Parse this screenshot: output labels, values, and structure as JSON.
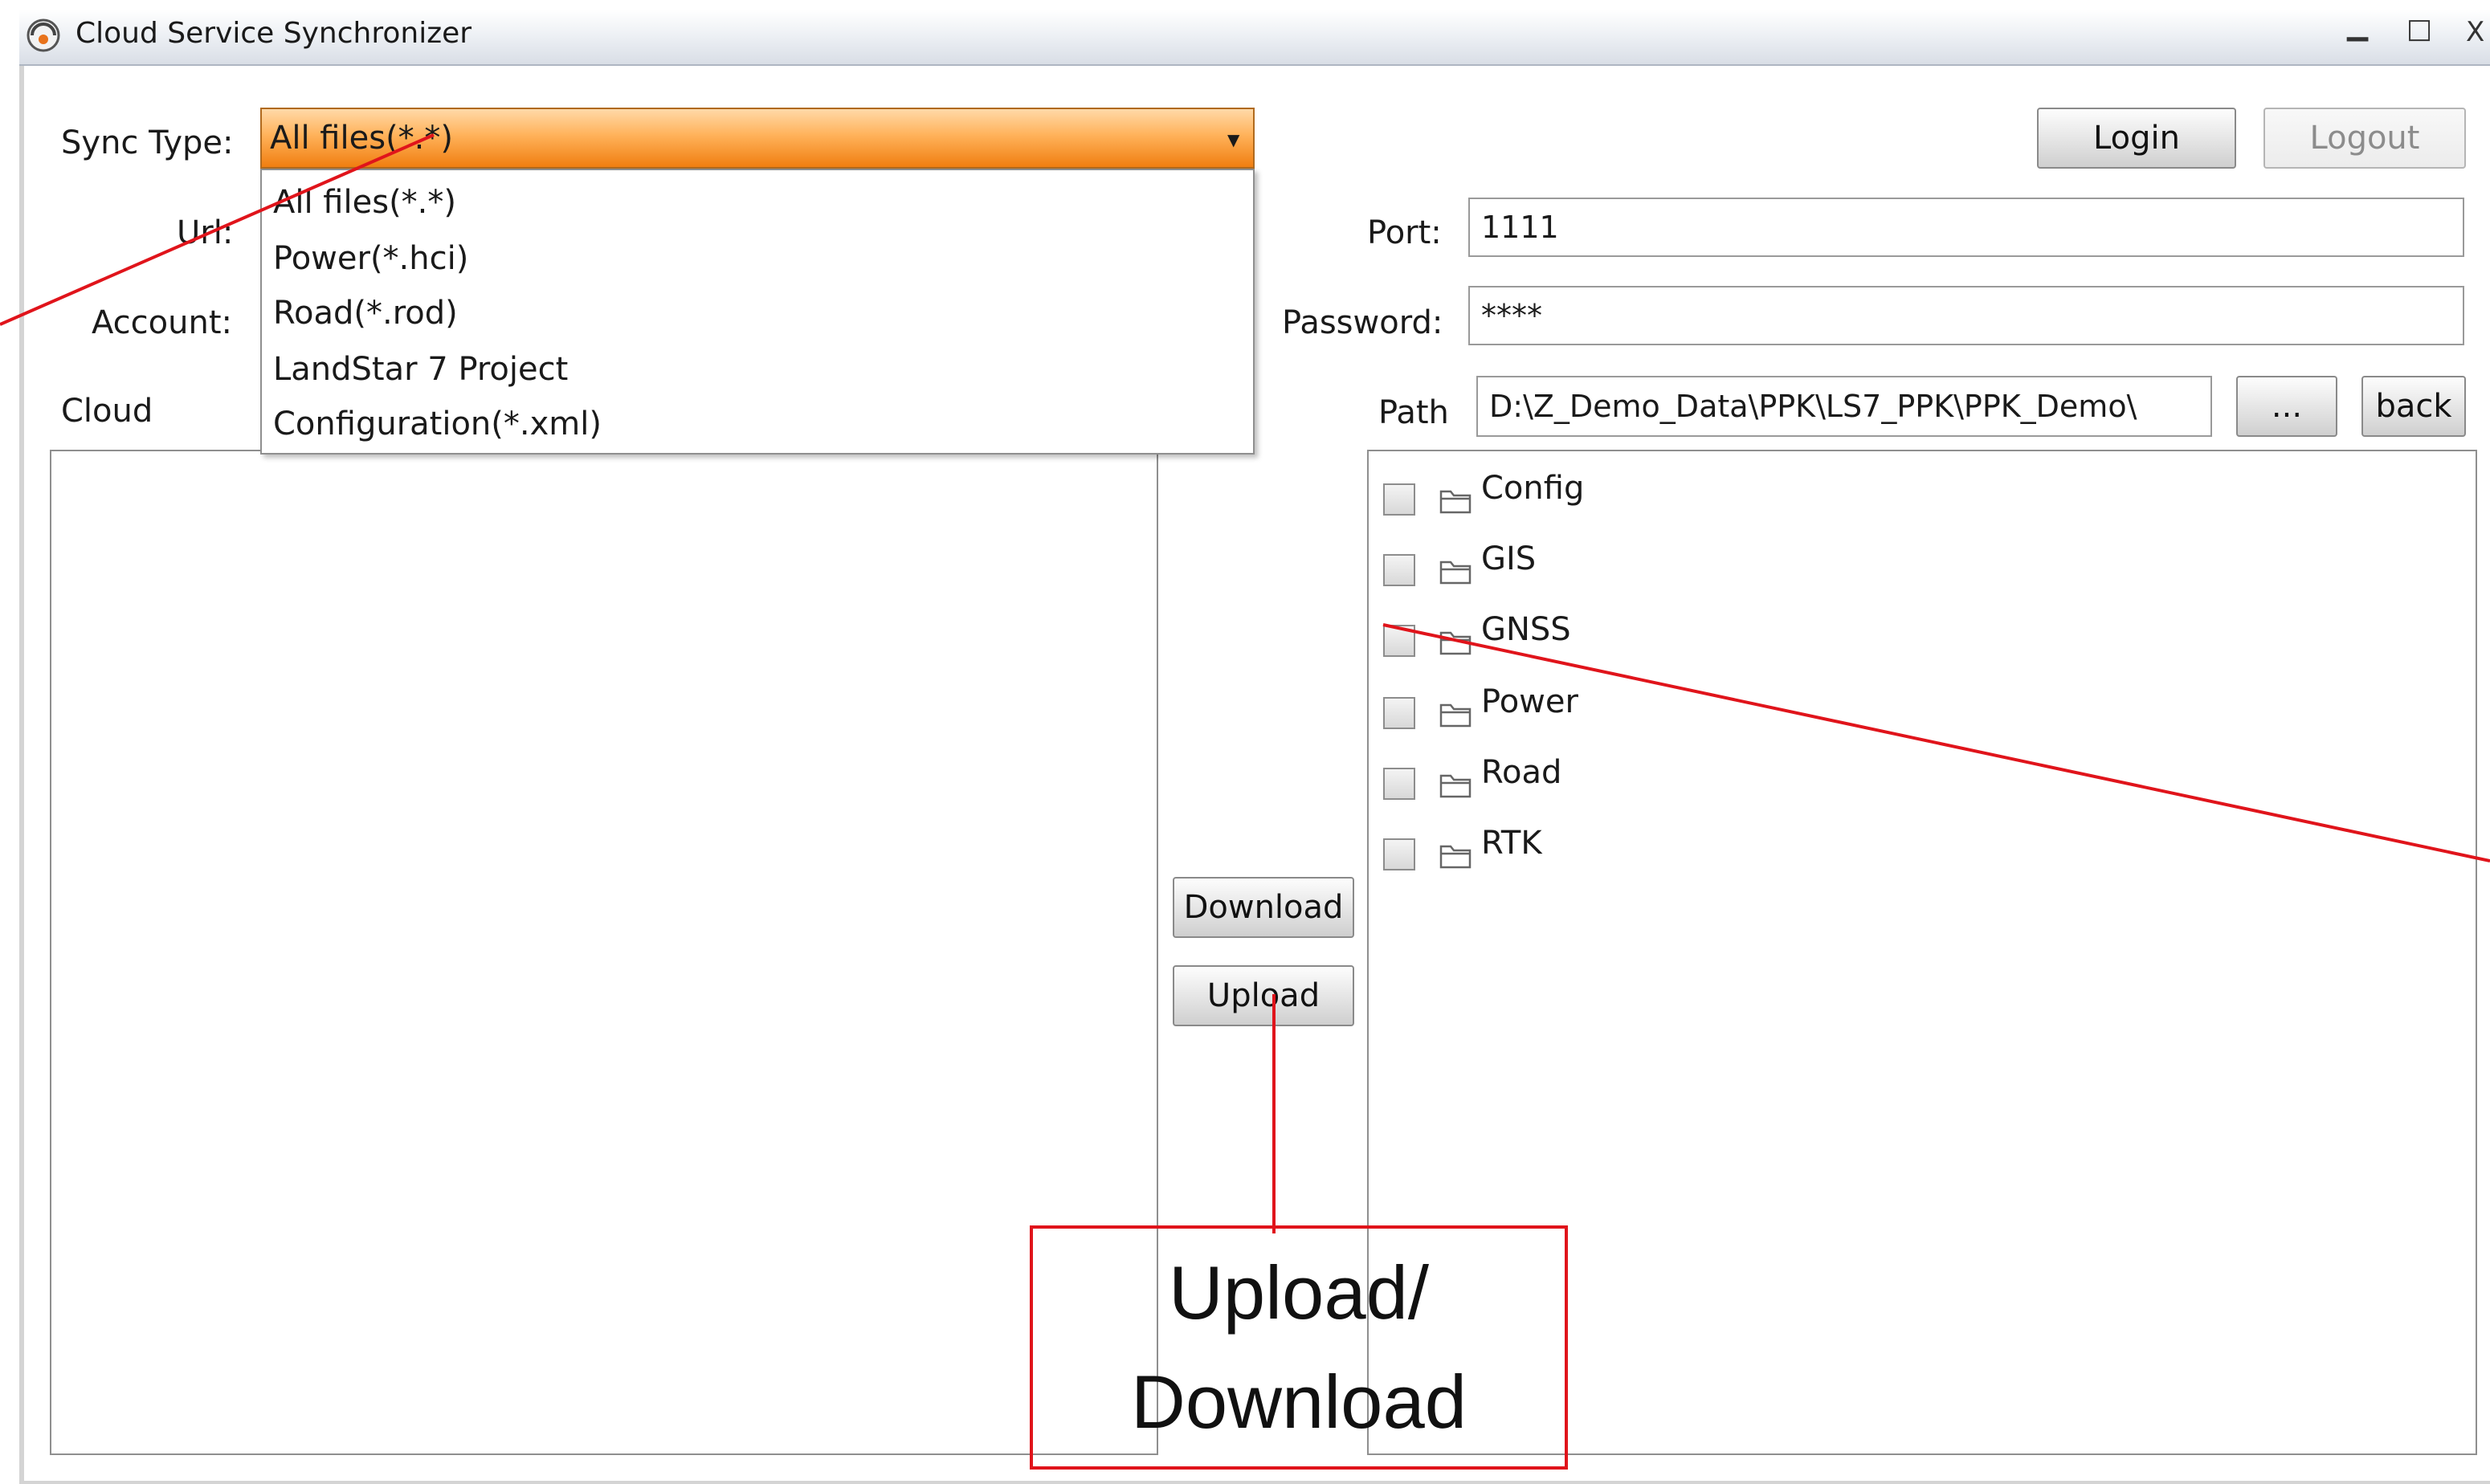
{
  "window": {
    "title": "Cloud Service Synchronizer",
    "minimize_glyph": "▁",
    "maximize_glyph": "□",
    "close_glyph": "X"
  },
  "form": {
    "sync_type_label": "Sync Type:",
    "sync_type_value": "All files(*.*)",
    "sync_type_options": [
      "All files(*.*)",
      "Power(*.hci)",
      "Road(*.rod)",
      "LandStar 7 Project",
      "Configuration(*.xml)"
    ],
    "url_label": "Url:",
    "account_label": "Account:",
    "port_label": "Port:",
    "port_value": "1111",
    "password_label": "Password:",
    "password_value": "****"
  },
  "auth": {
    "login_label": "Login",
    "logout_label": "Logout"
  },
  "cloud": {
    "label": "Cloud"
  },
  "local": {
    "path_label": "Path",
    "path_value": "D:\\Z_Demo_Data\\PPK\\LS7_PPK\\PPK_Demo\\",
    "browse_label": "...",
    "back_label": "back",
    "folders": [
      "Config",
      "GIS",
      "GNSS",
      "Power",
      "Road",
      "RTK"
    ]
  },
  "transfer": {
    "download_label": "Download",
    "upload_label": "Upload"
  },
  "annotation": {
    "line1": "Upload/",
    "line2": "Download",
    "color": "#e0141b"
  }
}
